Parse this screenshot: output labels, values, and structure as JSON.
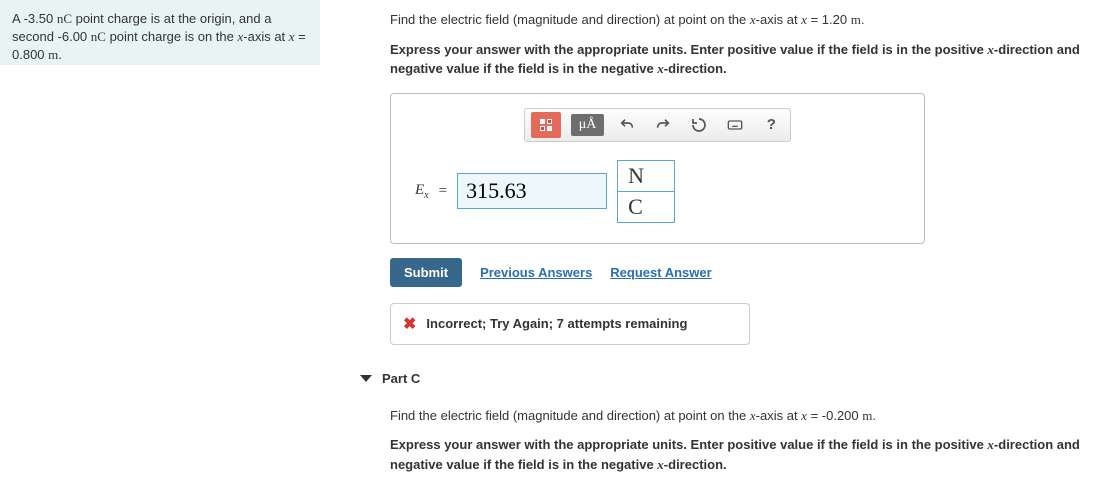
{
  "problem": {
    "line1_pre": "A -3.50 ",
    "line1_unit": "nC",
    "line1_post": " point charge is at the origin, and a second -6.00 ",
    "line1_unit2": "nC",
    "line1_post2": " point charge is on the ",
    "line1_var": "x",
    "line1_post3": "-axis at ",
    "line2_var": "x",
    "line2_post": " = 0.800 ",
    "line2_unit": "m",
    "line2_post2": "."
  },
  "partB": {
    "q_pre": "Find the electric field (magnitude and direction) at point on the ",
    "q_var": "x",
    "q_mid": "-axis at ",
    "q_var2": "x",
    "q_post": " = 1.20 ",
    "q_unit": "m",
    "q_post2": ".",
    "inst_pre": "Express your answer with the appropriate units. Enter positive value if the field is in the positive ",
    "inst_var": "x",
    "inst_mid": "-direction and negative value if the field is in the negative ",
    "inst_var2": "x",
    "inst_post": "-direction.",
    "mu_label": "μÅ",
    "help_label": "?",
    "ex_label": "E",
    "ex_sub": "x",
    "eq": "=",
    "value": "315.63",
    "unit_num": "N",
    "unit_den": "C",
    "submit": "Submit",
    "prev": "Previous Answers",
    "req": "Request Answer",
    "feedback": "Incorrect; Try Again; 7 attempts remaining"
  },
  "partC": {
    "header": "Part C",
    "q_pre": "Find the electric field (magnitude and direction) at point on the ",
    "q_var": "x",
    "q_mid": "-axis at ",
    "q_var2": "x",
    "q_post": " = -0.200 ",
    "q_unit": "m",
    "q_post2": ".",
    "inst_pre": "Express your answer with the appropriate units. Enter positive value if the field is in the positive ",
    "inst_var": "x",
    "inst_mid": "-direction and negative value if the field is in the negative ",
    "inst_var2": "x",
    "inst_post": "-direction."
  }
}
